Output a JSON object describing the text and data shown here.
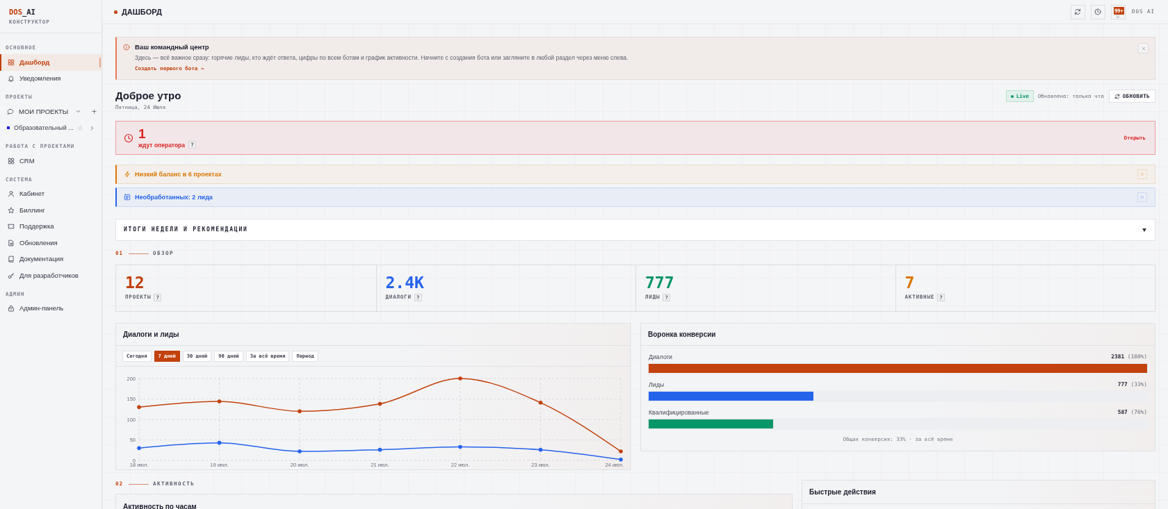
{
  "sidebar": {
    "logo": {
      "accent": "DOS",
      "text": "_AI"
    },
    "subtitle": "КОНСТРУКТОР",
    "sections": [
      {
        "title": "ОСНОВНОЕ",
        "items": [
          {
            "kind": "link",
            "label": "Дашборд",
            "selected": true
          },
          {
            "kind": "link",
            "label": "Уведомления",
            "selected": false
          }
        ]
      },
      {
        "title": "ПРОЕКТЫ",
        "items": [
          {
            "kind": "group",
            "label": "МОИ ПРОЕКТЫ",
            "expanded": true,
            "children": [
              {
                "kind": "project",
                "label": "Образовательный ...",
                "color": "#1a1ae6",
                "selected": false,
                "expanded": false
              }
            ]
          }
        ]
      },
      {
        "title": "РАБОТА С ПРОЕКТАМИ",
        "items": [
          {
            "kind": "link",
            "label": "CRM",
            "selected": false
          }
        ]
      },
      {
        "title": "СИСТЕМА",
        "items": [
          {
            "kind": "link",
            "label": "Кабинет",
            "selected": false
          },
          {
            "kind": "link",
            "label": "Биллинг",
            "selected": false
          },
          {
            "kind": "link",
            "label": "Поддержка",
            "selected": false
          },
          {
            "kind": "link",
            "label": "Обновления",
            "selected": false
          },
          {
            "kind": "link",
            "label": "Документация",
            "selected": false
          },
          {
            "kind": "link",
            "label": "Для разработчиков",
            "selected": false
          }
        ]
      },
      {
        "title": "АДМИН",
        "items": [
          {
            "kind": "link",
            "label": "Админ-панель",
            "selected": false
          }
        ]
      }
    ]
  },
  "topbar": {
    "title": "ДАШБОРД",
    "badge": "99+",
    "user": "DOS AI"
  },
  "notice": {
    "title": "Ваш командный центр",
    "text": "Здесь — всё важное сразу: горячие лиды, кто ждёт ответа, цифры по всем ботам и график активности. Начните с создания бота или загляните в любой раздел через меню слева.",
    "link": "Создать первого бота →"
  },
  "greeting": {
    "title": "Доброе утро",
    "date": "Пятница, 24 Июля",
    "live": "Live",
    "updated": "Обновлено: только что",
    "refresh": "ОБНОВИТЬ"
  },
  "alerts": [
    {
      "kind": "urgent",
      "count": "1",
      "label": "ждут оператора",
      "help": "?",
      "action": "Открыть"
    },
    {
      "kind": "warning",
      "text": "Низкий баланс в 6 проектах"
    },
    {
      "kind": "info",
      "text": "Необработанных: 2 лида"
    }
  ],
  "summary": {
    "title": "ИТОГИ НЕДЕЛИ И РЕКОМЕНДАЦИИ",
    "expanded": false
  },
  "overview": {
    "number": "01",
    "title": "ОБЗОР",
    "stats": [
      {
        "value": "12",
        "label": "ПРОЕКТЫ",
        "help": "?",
        "color": "#c2410c"
      },
      {
        "value": "2.4K",
        "label": "ДИАЛОГИ",
        "help": "?",
        "color": "#2563eb"
      },
      {
        "value": "777",
        "label": "ЛИДЫ",
        "help": "?",
        "color": "#059669"
      },
      {
        "value": "7",
        "label": "АКТИВНЫЕ",
        "help": "?",
        "color": "#d97706"
      }
    ]
  },
  "dialogs_chart": {
    "title": "Диалоги и лиды",
    "periods": [
      {
        "label": "Сегодня",
        "selected": false
      },
      {
        "label": "7 дней",
        "selected": true
      },
      {
        "label": "30 дней",
        "selected": false
      },
      {
        "label": "90 дней",
        "selected": false
      },
      {
        "label": "За всё время",
        "selected": false
      },
      {
        "label": "Период",
        "selected": false
      }
    ],
    "chart_data": {
      "type": "line",
      "categories": [
        "18 июл.",
        "19 июл.",
        "20 июл.",
        "21 июл.",
        "22 июл.",
        "23 июл.",
        "24 июл."
      ],
      "series": [
        {
          "color": "#c2410c",
          "values": [
            130,
            144,
            120,
            138,
            200,
            141,
            22
          ]
        },
        {
          "color": "#2563eb",
          "values": [
            30,
            43,
            22,
            26,
            33,
            26,
            2
          ]
        }
      ],
      "ylim": [
        0,
        200
      ],
      "yticks": [
        0,
        50,
        100,
        150,
        200
      ],
      "grid": true
    }
  },
  "funnel": {
    "title": "Воронка конверсии",
    "rows": [
      {
        "label": "Диалоги",
        "value": "**2381** (100%)",
        "level": 1,
        "color": "#c2410c"
      },
      {
        "label": "Лиды",
        "value": "**777** (33%)",
        "level": 0.33,
        "color": "#2563eb"
      },
      {
        "label": "Квалифицированные",
        "value": "**587** (76%)",
        "level": 0.25,
        "color": "#059669"
      }
    ],
    "footer": "Общая конверсия: 33% · за всё время"
  },
  "activity": {
    "number": "02",
    "title": "АКТИВНОСТЬ",
    "card_title": "Активность по часам"
  },
  "quick_actions": {
    "title": "Быстрые действия"
  }
}
